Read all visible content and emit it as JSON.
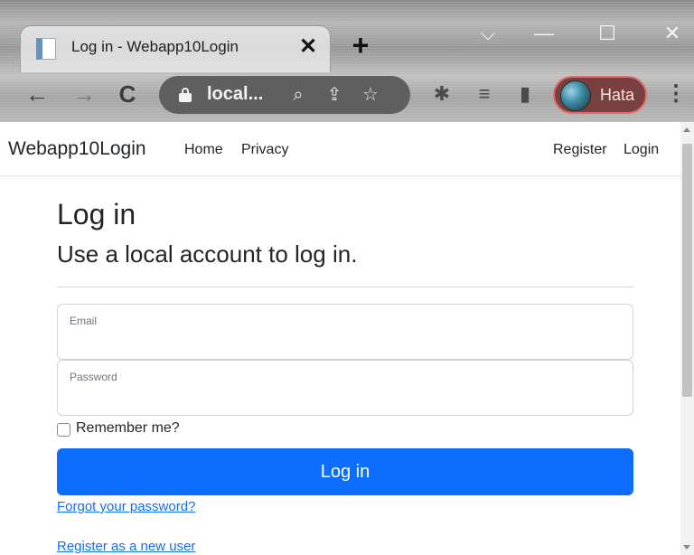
{
  "browser": {
    "tab_title": "Log in - Webapp10Login",
    "tab_close_glyph": "✕",
    "new_tab_glyph": "+",
    "window_controls": {
      "dropdown_glyph": "⌵",
      "minimize_glyph": "—",
      "maximize_glyph": "☐",
      "close_glyph": "✕"
    },
    "nav": {
      "back_glyph": "←",
      "forward_glyph": "→",
      "reload_glyph": "C"
    },
    "url": "local...",
    "omnibox_icons": {
      "zoom_glyph": "⌕",
      "share_glyph": "⇪",
      "star_glyph": "☆"
    },
    "extension_icons": {
      "puzzle_glyph": "✱",
      "media_glyph": "≡",
      "sidepanel_glyph": "▮"
    },
    "profile_name": "Hata",
    "menu_glyph": "⋮"
  },
  "site": {
    "brand": "Webapp10Login",
    "nav_left": [
      "Home",
      "Privacy"
    ],
    "nav_right": [
      "Register",
      "Login"
    ]
  },
  "login": {
    "heading": "Log in",
    "subheading": "Use a local account to log in.",
    "email_label": "Email",
    "email_value": "",
    "password_label": "Password",
    "password_value": "",
    "remember_label": "Remember me?",
    "remember_checked": false,
    "submit_label": "Log in",
    "forgot_link": "Forgot your password?",
    "register_link": "Register as a new user"
  },
  "colors": {
    "primary": "#0d6efd",
    "text": "#212529",
    "muted": "#6c757d",
    "profile_bg": "#7a3f3f",
    "omnibox_bg": "#5f5f5f"
  }
}
